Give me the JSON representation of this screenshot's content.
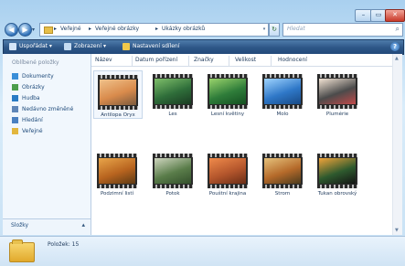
{
  "window": {
    "minimize": "–",
    "maximize": "▭",
    "close": "✕"
  },
  "nav": {
    "back": "◀",
    "forward": "▶",
    "history_dropdown": "▾",
    "breadcrumbs": [
      "Veřejné",
      "Veřejné obrázky",
      "Ukázky obrázků"
    ],
    "crumb_separator": "▸",
    "address_dropdown": "▾",
    "refresh": "↻",
    "search_placeholder": "Hledat",
    "search_icon": "⌕"
  },
  "toolbar": {
    "organize": "Uspořádat",
    "views": "Zobrazení",
    "slideshow": "Nastavení sdílení",
    "help": "?"
  },
  "sidebar": {
    "title": "Oblíbené položky",
    "items": [
      {
        "label": "Dokumenty",
        "icon": "documents-icon",
        "color": "#3a8ed8"
      },
      {
        "label": "Obrázky",
        "icon": "pictures-icon",
        "color": "#4c9e4c"
      },
      {
        "label": "Hudba",
        "icon": "music-icon",
        "color": "#2a7bc4"
      },
      {
        "label": "Nedávno změněné",
        "icon": "recent-icon",
        "color": "#5f86b8"
      },
      {
        "label": "Hledání",
        "icon": "searches-icon",
        "color": "#4a80c0"
      },
      {
        "label": "Veřejné",
        "icon": "folder-icon",
        "color": "#e2b63d"
      }
    ],
    "folders_label": "Složky",
    "folders_chevron": "▴"
  },
  "columns": [
    "Název",
    "Datum pořízení",
    "Značky",
    "Velikost",
    "Hodnocení"
  ],
  "files": [
    {
      "name": "Antilopa Oryx",
      "colors": [
        "#d98b4c",
        "#f0c28b",
        "#7b5a3d"
      ]
    },
    {
      "name": "Les",
      "colors": [
        "#2f6e3a",
        "#7fbf6a",
        "#1a3c22"
      ]
    },
    {
      "name": "Lesní květiny",
      "colors": [
        "#2f7d3a",
        "#9ad46c",
        "#145021"
      ]
    },
    {
      "name": "Molo",
      "colors": [
        "#2f78c8",
        "#9fd4ff",
        "#184a86"
      ]
    },
    {
      "name": "Plumérie",
      "colors": [
        "#4b4b4b",
        "#f3e4d4",
        "#c14a4a"
      ]
    },
    {
      "name": "Podzimní listí",
      "colors": [
        "#b8641f",
        "#e9a64a",
        "#5d3a14"
      ]
    },
    {
      "name": "Potok",
      "colors": [
        "#5a7d4a",
        "#cfd6bf",
        "#34502c"
      ]
    },
    {
      "name": "Pouštní krajina",
      "colors": [
        "#b4562c",
        "#f08b4b",
        "#6a2d16"
      ]
    },
    {
      "name": "Strom",
      "colors": [
        "#b56a2a",
        "#e6c27c",
        "#4b3b1d"
      ]
    },
    {
      "name": "Tukan obrovský",
      "colors": [
        "#2e5a2e",
        "#f1a43a",
        "#141414"
      ]
    }
  ],
  "details": {
    "count": "Položek: 15"
  },
  "colors": {
    "toolbar": "#2d5687",
    "selection": "#f2f7fd"
  }
}
